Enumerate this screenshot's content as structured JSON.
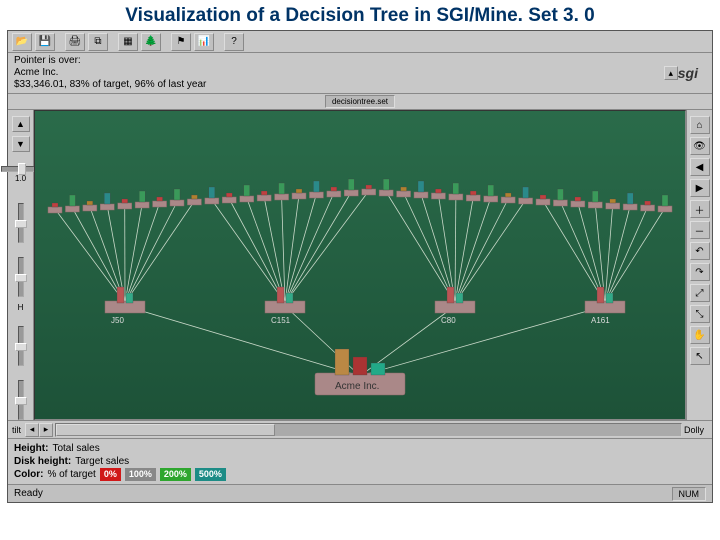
{
  "title": "Visualization of a Decision Tree in SGI/Mine. Set 3. 0",
  "logo": "sgi",
  "pointer_info": {
    "label": "Pointer is over:",
    "name": "Acme Inc.",
    "detail": "$33,346.01, 83% of target, 96% of last year"
  },
  "path_bar": "decisiontree.set",
  "left_panel": {
    "slider1_label": "1.0",
    "slider2_label": "H"
  },
  "hscroll": {
    "left_label": "tilt",
    "right_label": "Dolly"
  },
  "legend": {
    "line1_label": "Height:",
    "line1_value": "Total sales",
    "line2_label": "Disk height:",
    "line2_value": "Target sales",
    "line3_label": "Color:",
    "line3_value": "% of target",
    "swatch1": "0%",
    "swatch2": "100%",
    "swatch3": "200%",
    "swatch4": "500%"
  },
  "status": {
    "left": "Ready",
    "right": "NUM"
  },
  "root_node": "Acme Inc.",
  "mid_nodes": [
    "J50",
    "C151",
    "C80",
    "A161"
  ]
}
